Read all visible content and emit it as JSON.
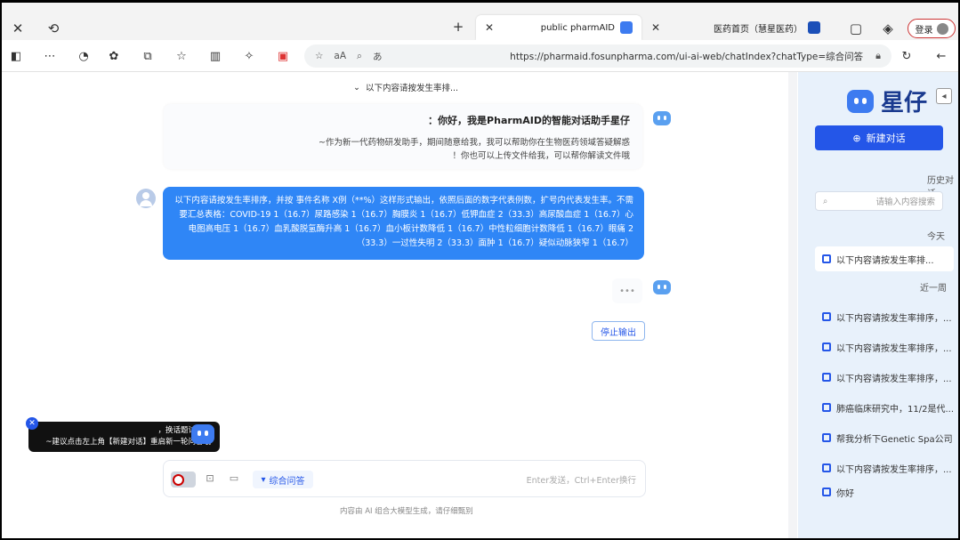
{
  "browser": {
    "tabs": [
      {
        "label": "医药首页（慧星医药）",
        "active": false
      },
      {
        "label": "public pharmAID",
        "active": true
      }
    ],
    "login_label": "登录",
    "url": "https://pharmaid.fosunpharma.com/ui-ai-web/chatIndex?chatType=综合问答",
    "zoom_label": "aA"
  },
  "sidebar": {
    "brand": "星仔",
    "new_chat_label": "新建对话",
    "history_label": "历史对话",
    "search_placeholder": "请输入内容搜索",
    "today_label": "今天",
    "today_items": [
      {
        "label": "以下内容请按发生率排...",
        "active": true
      }
    ],
    "week_label": "近一周",
    "week_items": [
      {
        "label": "以下内容请按发生率排序，..."
      },
      {
        "label": "以下内容请按发生率排序，..."
      },
      {
        "label": "以下内容请按发生率排序，..."
      },
      {
        "label": "肺癌临床研究中，11/2是代..."
      },
      {
        "label": "帮我分析下Genetic Spa公司"
      },
      {
        "label": "以下内容请按发生率排序，..."
      },
      {
        "label": "你好"
      }
    ]
  },
  "chat": {
    "title": "以下内容请按发生率排...",
    "greeting_title": "你好，我是PharmAID的智能对话助手星仔：",
    "greeting_lines": [
      "作为新一代药物研发助手，期间随意给我，我可以帮助你在生物医药领域答疑解惑~",
      "你也可以上传文件给我，可以帮你解读文件哦！"
    ],
    "user_message": "以下内容请按发生率排序，并按 事件名称 X例（**%）这样形式输出，依照后面的数字代表例数，扩号内代表发生率。不需要汇总表格：COVID-19 1（16.7）尿路感染 1（16.7）胸膜炎 1（16.7）低钾血症 2（33.3）高尿酸血症 1（16.7）心电图高电压 1（16.7）血乳酸脱氢酶升高 1（16.7）血小板计数降低 1（16.7）中性粒细胞计数降低 1（16.7）眼痛 2（33.3）一过性失明 2（33.3）面肿 1（16.7）疑似动脉狭窄 1（16.7）",
    "loading_text": "•••",
    "stop_label": "停止输出",
    "input_placeholder": "Enter发送，Ctrl+Enter换行",
    "mode_label": "综合问答",
    "footnote": "内容由 AI 组合大模型生成，请仔细甄别"
  },
  "tip": {
    "line1": "换话题讨论时，",
    "line2": "建议点击左上角【新建对话】重启新一轮问答哦~"
  },
  "colors": {
    "accent": "#2456e8",
    "user_bubble": "#2f86f6",
    "sidebar_bg": "#e8f1fb"
  }
}
